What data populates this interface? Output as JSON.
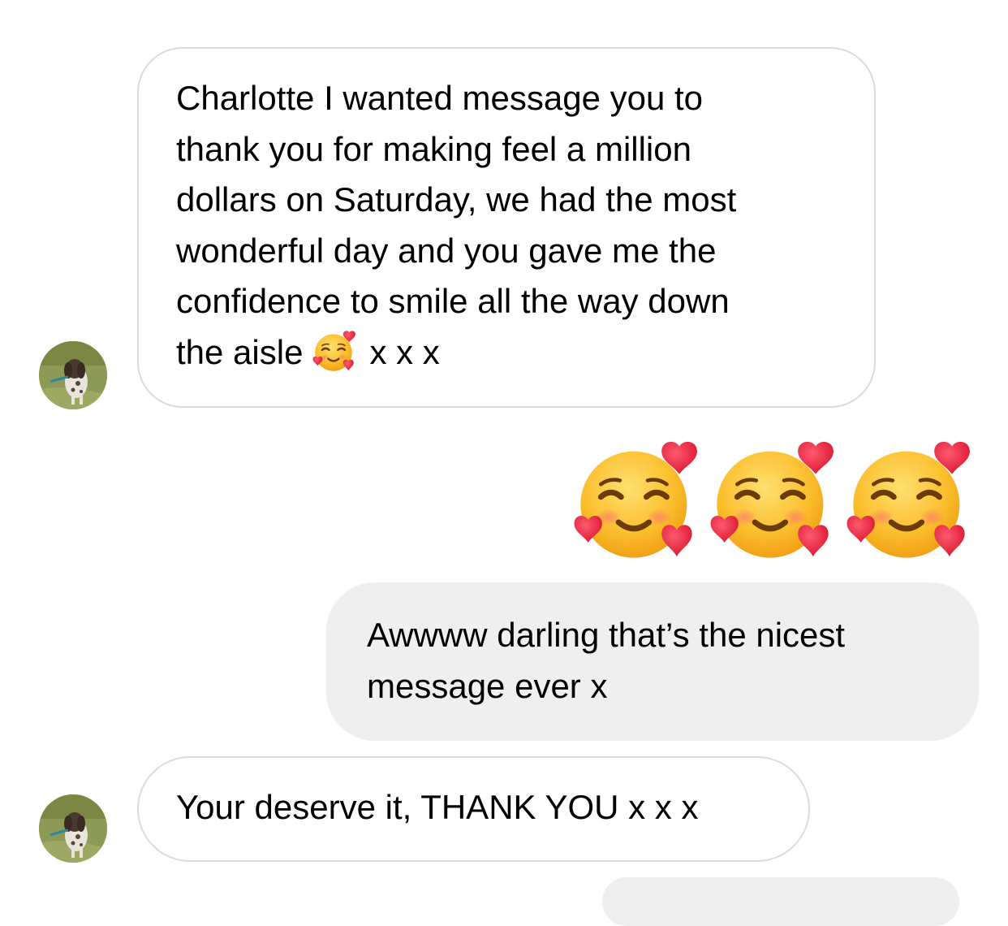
{
  "conversation": {
    "messages": [
      {
        "direction": "incoming",
        "text_before_emoji": "Charlotte I wanted message you to\nthank you for making feel a million\ndollars on Saturday, we had the most\nwonderful day and you gave me the\nconfidence to smile all the way down\nthe aisle",
        "emoji": "smiling-face-with-hearts-icon",
        "text_after_emoji": "x x x"
      },
      {
        "direction": "outgoing",
        "emoji_only": true,
        "emojis": [
          "smiling-face-with-hearts-icon",
          "smiling-face-with-hearts-icon",
          "smiling-face-with-hearts-icon"
        ]
      },
      {
        "direction": "outgoing",
        "text": "Awwww darling that’s the nicest\nmessage ever x"
      },
      {
        "direction": "incoming",
        "text": "Your deserve it, THANK YOU x x x"
      }
    ]
  },
  "colors": {
    "incoming_bubble_border": "#dbdbdb",
    "outgoing_bubble_bg": "#efefef"
  }
}
